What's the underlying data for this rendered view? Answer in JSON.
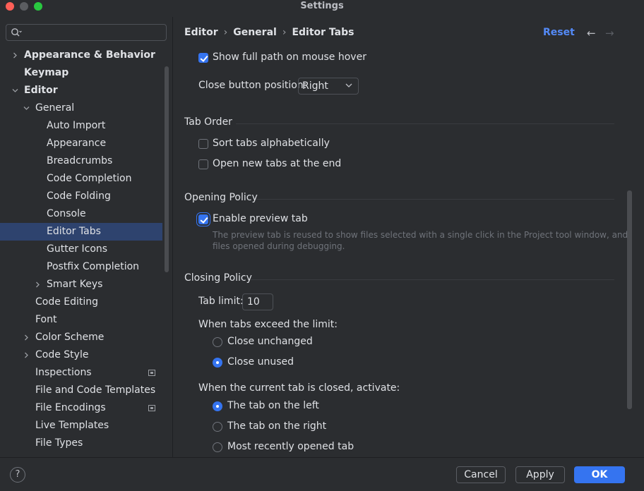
{
  "window": {
    "title": "Settings"
  },
  "search": {
    "placeholder": ""
  },
  "sidebar": {
    "items": [
      {
        "label": "Appearance & Behavior",
        "expandable": true,
        "expanded": false
      },
      {
        "label": "Keymap"
      },
      {
        "label": "Editor",
        "expandable": true,
        "expanded": true
      },
      {
        "label": "General",
        "expandable": true,
        "expanded": true
      },
      {
        "label": "Auto Import"
      },
      {
        "label": "Appearance"
      },
      {
        "label": "Breadcrumbs"
      },
      {
        "label": "Code Completion"
      },
      {
        "label": "Code Folding"
      },
      {
        "label": "Console"
      },
      {
        "label": "Editor Tabs",
        "selected": true
      },
      {
        "label": "Gutter Icons"
      },
      {
        "label": "Postfix Completion"
      },
      {
        "label": "Smart Keys",
        "expandable": true,
        "expanded": false
      },
      {
        "label": "Code Editing"
      },
      {
        "label": "Font"
      },
      {
        "label": "Color Scheme",
        "expandable": true,
        "expanded": false
      },
      {
        "label": "Code Style",
        "expandable": true,
        "expanded": false
      },
      {
        "label": "Inspections",
        "modified_icon": true
      },
      {
        "label": "File and Code Templates"
      },
      {
        "label": "File Encodings",
        "modified_icon": true
      },
      {
        "label": "Live Templates"
      },
      {
        "label": "File Types"
      }
    ]
  },
  "breadcrumb": {
    "items": [
      "Editor",
      "General",
      "Editor Tabs"
    ]
  },
  "header": {
    "reset_label": "Reset",
    "back_icon": "←",
    "forward_icon": "→"
  },
  "settings": {
    "show_full_path": {
      "label": "Show full path on mouse hover",
      "checked": true
    },
    "close_button_position": {
      "label": "Close button position:",
      "value": "Right"
    },
    "tab_order": {
      "title": "Tab Order",
      "sort_alphabetically": {
        "label": "Sort tabs alphabetically",
        "checked": false
      },
      "open_at_end": {
        "label": "Open new tabs at the end",
        "checked": false
      }
    },
    "opening_policy": {
      "title": "Opening Policy",
      "enable_preview": {
        "label": "Enable preview tab",
        "checked": true
      },
      "hint_line1": "The preview tab is reused to show files selected with a single click in the Project tool window, and",
      "hint_line2": "files opened during debugging."
    },
    "closing_policy": {
      "title": "Closing Policy",
      "tab_limit_label": "Tab limit:",
      "tab_limit_value": "10",
      "exceed_label": "When tabs exceed the limit:",
      "close_unchanged": {
        "label": "Close unchanged",
        "selected": false
      },
      "close_unused": {
        "label": "Close unused",
        "selected": true
      },
      "activate_label": "When the current tab is closed, activate:",
      "tab_left": {
        "label": "The tab on the left",
        "selected": true
      },
      "tab_right": {
        "label": "The tab on the right",
        "selected": false
      },
      "most_recent": {
        "label": "Most recently opened tab",
        "selected": false
      }
    }
  },
  "footer": {
    "help_label": "?",
    "cancel_label": "Cancel",
    "apply_label": "Apply",
    "ok_label": "OK"
  },
  "colors": {
    "accent": "#3574f0",
    "link": "#548af7",
    "background": "#2b2d30",
    "selection": "#2e436e"
  }
}
